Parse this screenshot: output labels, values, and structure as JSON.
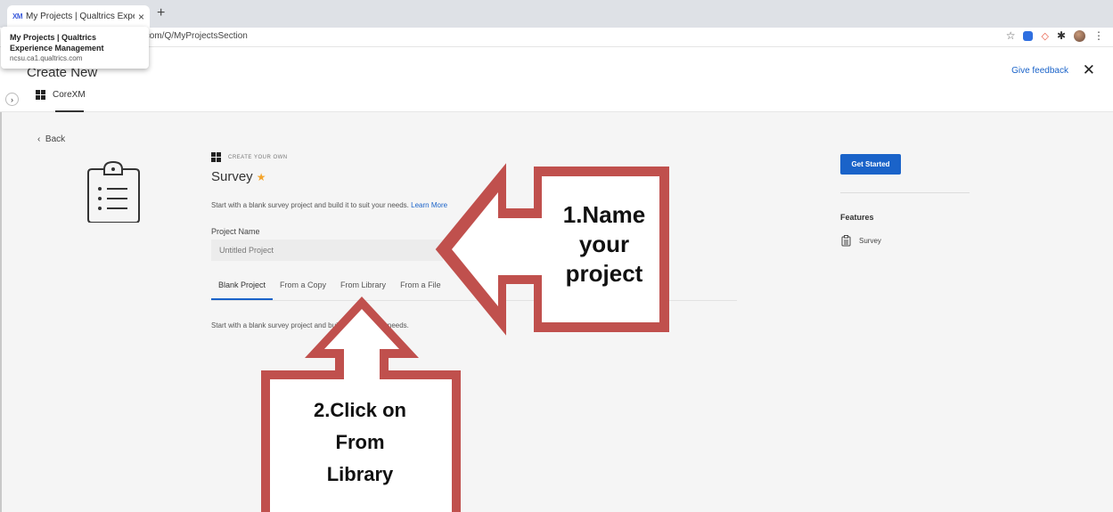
{
  "browser": {
    "tab_favicon": "XM",
    "tab_title": "My Projects | Qualtrics Experie",
    "tab_close": "×",
    "new_tab": "+",
    "url_visible": ".com/Q/MyProjectsSection",
    "tooltip_title": "My Projects | Qualtrics Experience Management",
    "tooltip_url": "ncsu.ca1.qualtrics.com",
    "icons": [
      "star-icon",
      "extension-icon",
      "extension-icon",
      "puzzle-icon",
      "profile-avatar",
      "more-menu-icon"
    ]
  },
  "header": {
    "title": "Create New",
    "nav_tab": "CoreXM",
    "feedback": "Give feedback",
    "close": "✕",
    "sidebar_toggle": "›"
  },
  "main": {
    "back": "Back",
    "eyebrow": "CREATE YOUR OWN",
    "title": "Survey",
    "star": "★",
    "description": "Start with a blank survey project and build it to suit your needs.",
    "learn_more": "Learn More",
    "project_name_label": "Project Name",
    "project_name_value": "Untitled Project",
    "tabs": [
      {
        "label": "Blank Project",
        "active": true
      },
      {
        "label": "From a Copy",
        "active": false
      },
      {
        "label": "From Library",
        "active": false
      },
      {
        "label": "From a File",
        "active": false
      }
    ],
    "tab_description": "Start with a blank survey project and build it to suit your needs."
  },
  "right_panel": {
    "get_started": "Get Started",
    "features_label": "Features",
    "feature_item": "Survey"
  },
  "annotations": {
    "step1": [
      "1.Name",
      "your",
      "project"
    ],
    "step2": [
      "2.Click on",
      "From",
      "Library"
    ],
    "arrow_color": "#c0504d"
  },
  "colors": {
    "accent_blue": "#1a63c9",
    "star_orange": "#f4a42b"
  }
}
